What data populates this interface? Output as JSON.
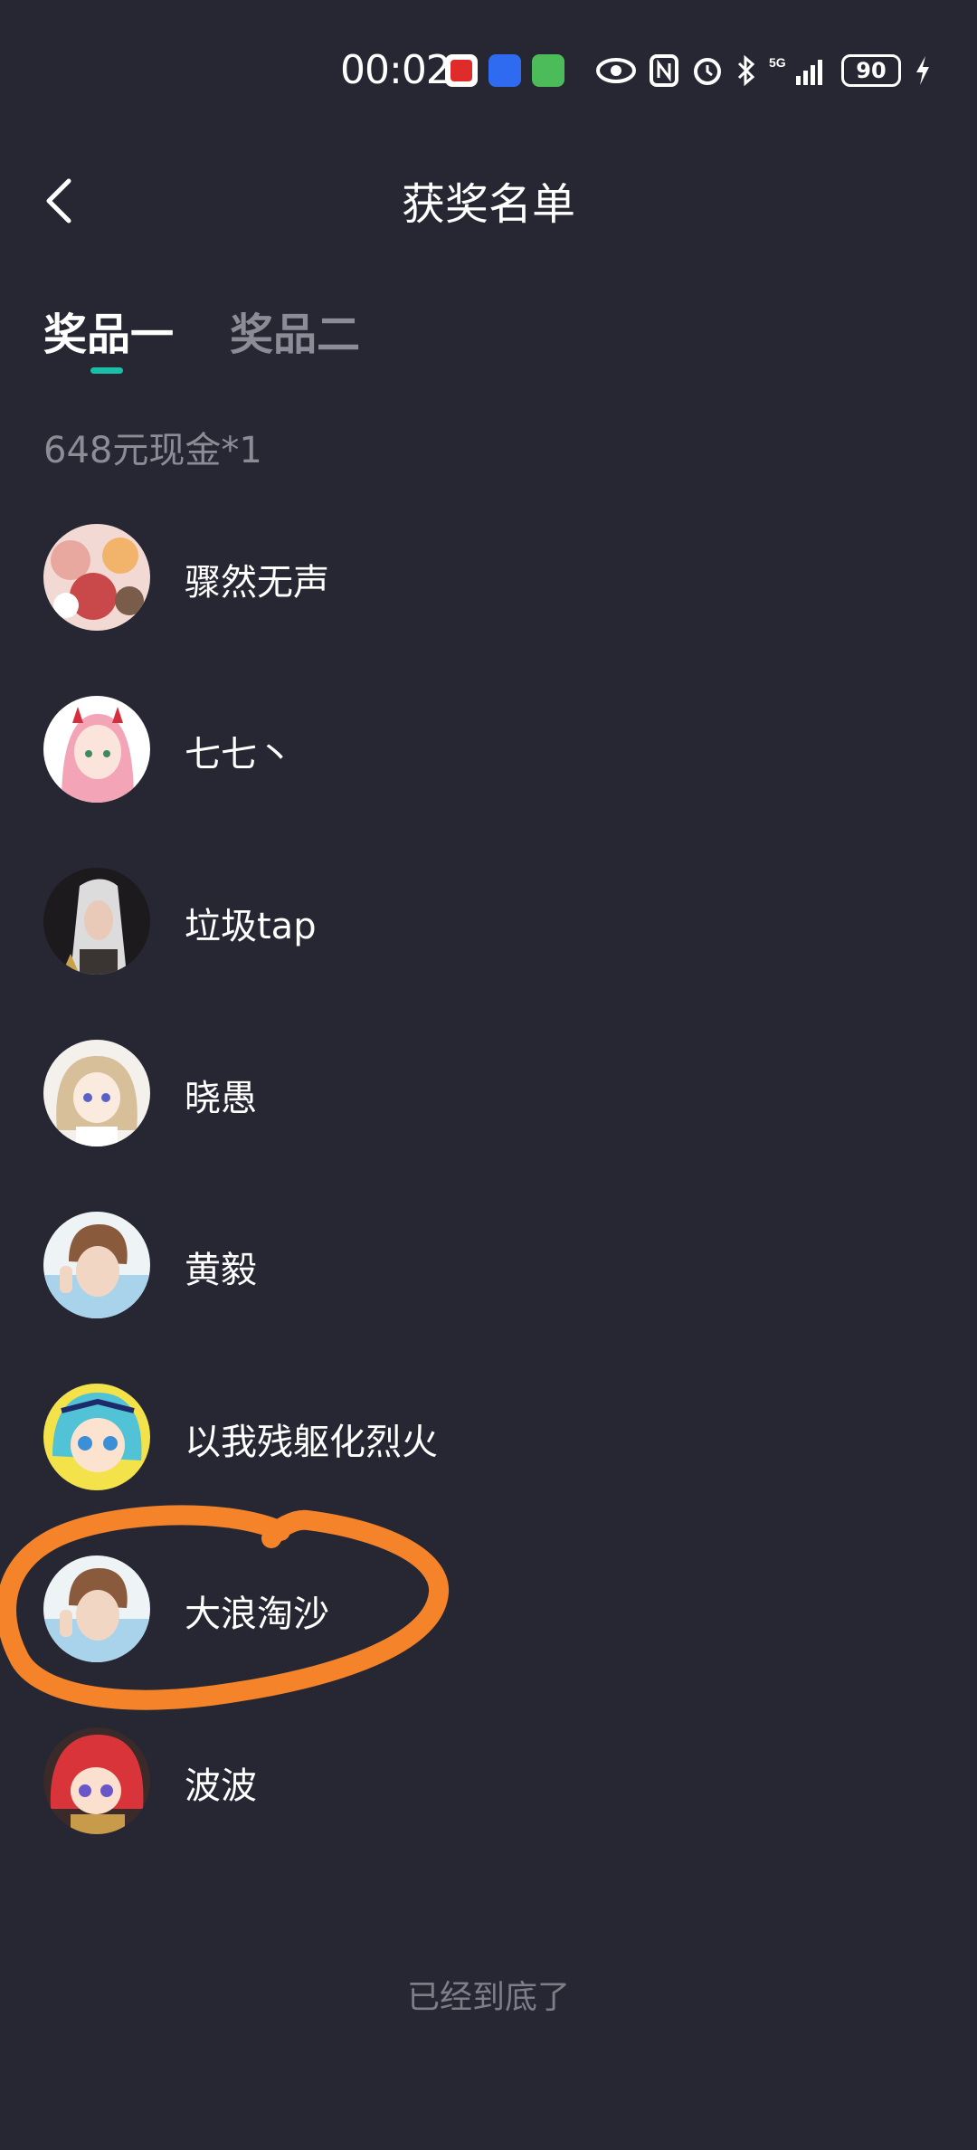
{
  "status_bar": {
    "time": "00:02",
    "battery": "90"
  },
  "header": {
    "title": "获奖名单"
  },
  "tabs": [
    {
      "label": "奖品一",
      "active": true
    },
    {
      "label": "奖品二",
      "active": false
    }
  ],
  "prize": {
    "label": "648元现金*1"
  },
  "winners": [
    {
      "name": "骤然无声"
    },
    {
      "name": "七七丶"
    },
    {
      "name": "垃圾tap"
    },
    {
      "name": "晓愚"
    },
    {
      "name": "黄毅"
    },
    {
      "name": "以我残躯化烈火"
    },
    {
      "name": "大浪淘沙"
    },
    {
      "name": "波波"
    }
  ],
  "footer": {
    "end_text": "已经到底了"
  },
  "colors": {
    "background": "#262733",
    "accent": "#1bbfa7",
    "highlight_mark": "#f5832a"
  }
}
